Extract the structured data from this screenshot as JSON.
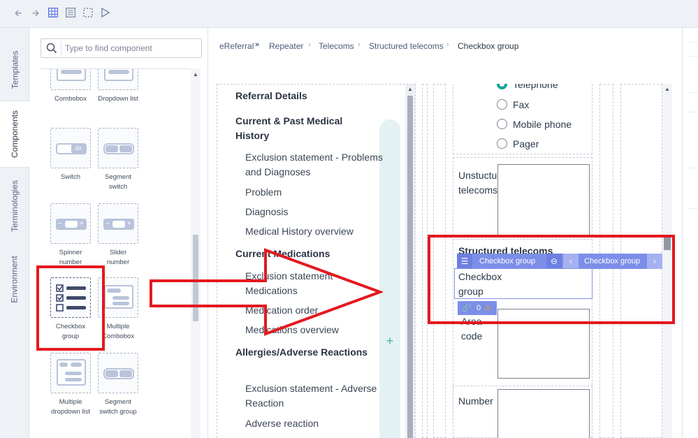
{
  "palette": {
    "search_placeholder": "Type to find component",
    "components": [
      {
        "id": "combobox",
        "label": "Combobox"
      },
      {
        "id": "dropdown-list",
        "label": "Dropdown list"
      },
      {
        "id": "switch",
        "label": "Switch"
      },
      {
        "id": "segment-switch",
        "label": "Segment switch"
      },
      {
        "id": "spinner-number",
        "label": "Spinner number"
      },
      {
        "id": "slider-number",
        "label": "Slider number"
      },
      {
        "id": "checkbox-group",
        "label": "Checkbox group"
      },
      {
        "id": "multiple-combobox",
        "label": "Multiple Combobox"
      },
      {
        "id": "multiple-dropdown-list",
        "label": "Multiple dropdown list"
      },
      {
        "id": "segment-switch-group",
        "label": "Segment switch group"
      }
    ],
    "switch_tile_text": "Да"
  },
  "rail_tabs": [
    "Templates",
    "Components",
    "Terminologies",
    "Environment"
  ],
  "breadcrumb": [
    "eReferral",
    "Repeater",
    "Telecoms",
    "Structured telecoms",
    "Checkbox group"
  ],
  "outline": {
    "items": [
      {
        "text": "Referral Details",
        "kind": "h"
      },
      {
        "text": "Current & Past Medical History",
        "kind": "h"
      },
      {
        "text": "Exclusion statement - Problems and Diagnoses",
        "kind": "s"
      },
      {
        "text": "Problem",
        "kind": "s"
      },
      {
        "text": "Diagnosis",
        "kind": "s"
      },
      {
        "text": "Medical History overview",
        "kind": "s"
      },
      {
        "text": "Current Medications",
        "kind": "h"
      },
      {
        "text": "Exclusion statement - Medications",
        "kind": "s"
      },
      {
        "text": "Medication order",
        "kind": "s"
      },
      {
        "text": "Medications overview",
        "kind": "s"
      },
      {
        "text": "Allergies/Adverse Reactions",
        "kind": "h"
      },
      {
        "text": "Exclusion statement - Adverse Reaction",
        "kind": "s"
      },
      {
        "text": "Adverse reaction",
        "kind": "s"
      }
    ],
    "add_symbol": "+"
  },
  "canvas": {
    "radio_options": [
      {
        "label": "Telephone",
        "checked": true
      },
      {
        "label": "Fax",
        "checked": false
      },
      {
        "label": "Mobile phone",
        "checked": false
      },
      {
        "label": "Pager",
        "checked": false
      }
    ],
    "unstructured_label": "Unstuctured telecoms",
    "structured_label": "Structured telecoms",
    "selection": {
      "type_label": "Checkbox group",
      "next_label": "Checkbox group",
      "field_label": "Checkbox group",
      "link_count": "0"
    },
    "area_code_label": "Area code",
    "number_label": "Number"
  },
  "colors": {
    "accent": "#7c8fe8",
    "teal": "#17a29a",
    "annotation_red": "#e3191f"
  }
}
